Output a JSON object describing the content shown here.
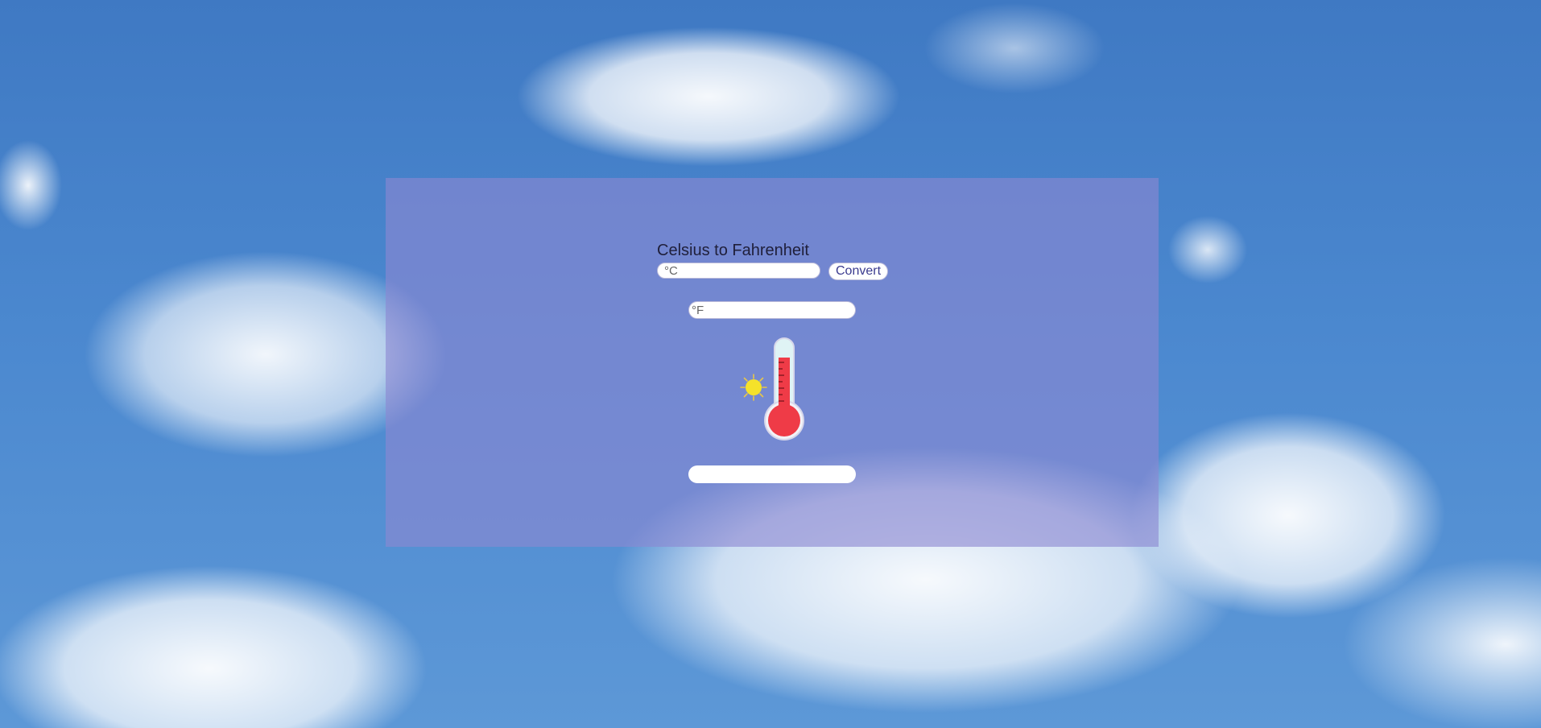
{
  "converter": {
    "title": "Celsius to Fahrenheit",
    "celsius_placeholder": "°C",
    "celsius_value": "",
    "convert_label": "Convert",
    "fahrenheit_placeholder": "°F",
    "fahrenheit_value": "",
    "result_text": ""
  },
  "illustration": {
    "icons": [
      "sun-icon",
      "thermometer-icon"
    ]
  },
  "colors": {
    "panel": "#8c87d2",
    "sky": "#4b88cf",
    "thermometer_liquid": "#ef3b47",
    "sun": "#f5e22a"
  }
}
